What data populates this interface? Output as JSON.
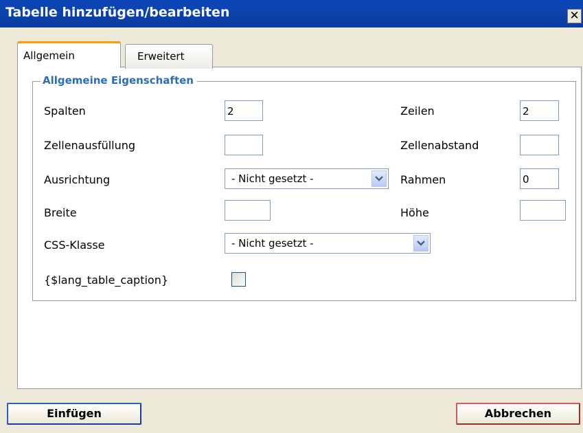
{
  "window": {
    "title": "Tabelle hinzufügen/bearbeiten",
    "close_glyph": "✕"
  },
  "tabs": [
    {
      "label": "Allgemein",
      "active": true
    },
    {
      "label": "Erweitert",
      "active": false
    }
  ],
  "general": {
    "legend": "Allgemeine Eigenschaften",
    "columns": {
      "label": "Spalten",
      "value": "2"
    },
    "rows": {
      "label": "Zeilen",
      "value": "2"
    },
    "cellpadding": {
      "label": "Zellenausfüllung",
      "value": ""
    },
    "cellspacing": {
      "label": "Zellenabstand",
      "value": ""
    },
    "align": {
      "label": "Ausrichtung",
      "value": "- Nicht gesetzt -"
    },
    "border": {
      "label": "Rahmen",
      "value": "0"
    },
    "width": {
      "label": "Breite",
      "value": ""
    },
    "height": {
      "label": "Höhe",
      "value": ""
    },
    "css_class": {
      "label": "CSS-Klasse",
      "value": "- Nicht gesetzt -"
    },
    "caption": {
      "label": "{$lang_table_caption}",
      "checked": false
    }
  },
  "buttons": {
    "insert": "Einfügen",
    "cancel": "Abbrechen"
  },
  "icons": {
    "close": "close-icon",
    "dropdown": "chevron-down-icon"
  },
  "colors": {
    "titlebar": "#0a3c9e",
    "legend": "#2b6db8",
    "tab_active_accent": "#ff9d00"
  }
}
